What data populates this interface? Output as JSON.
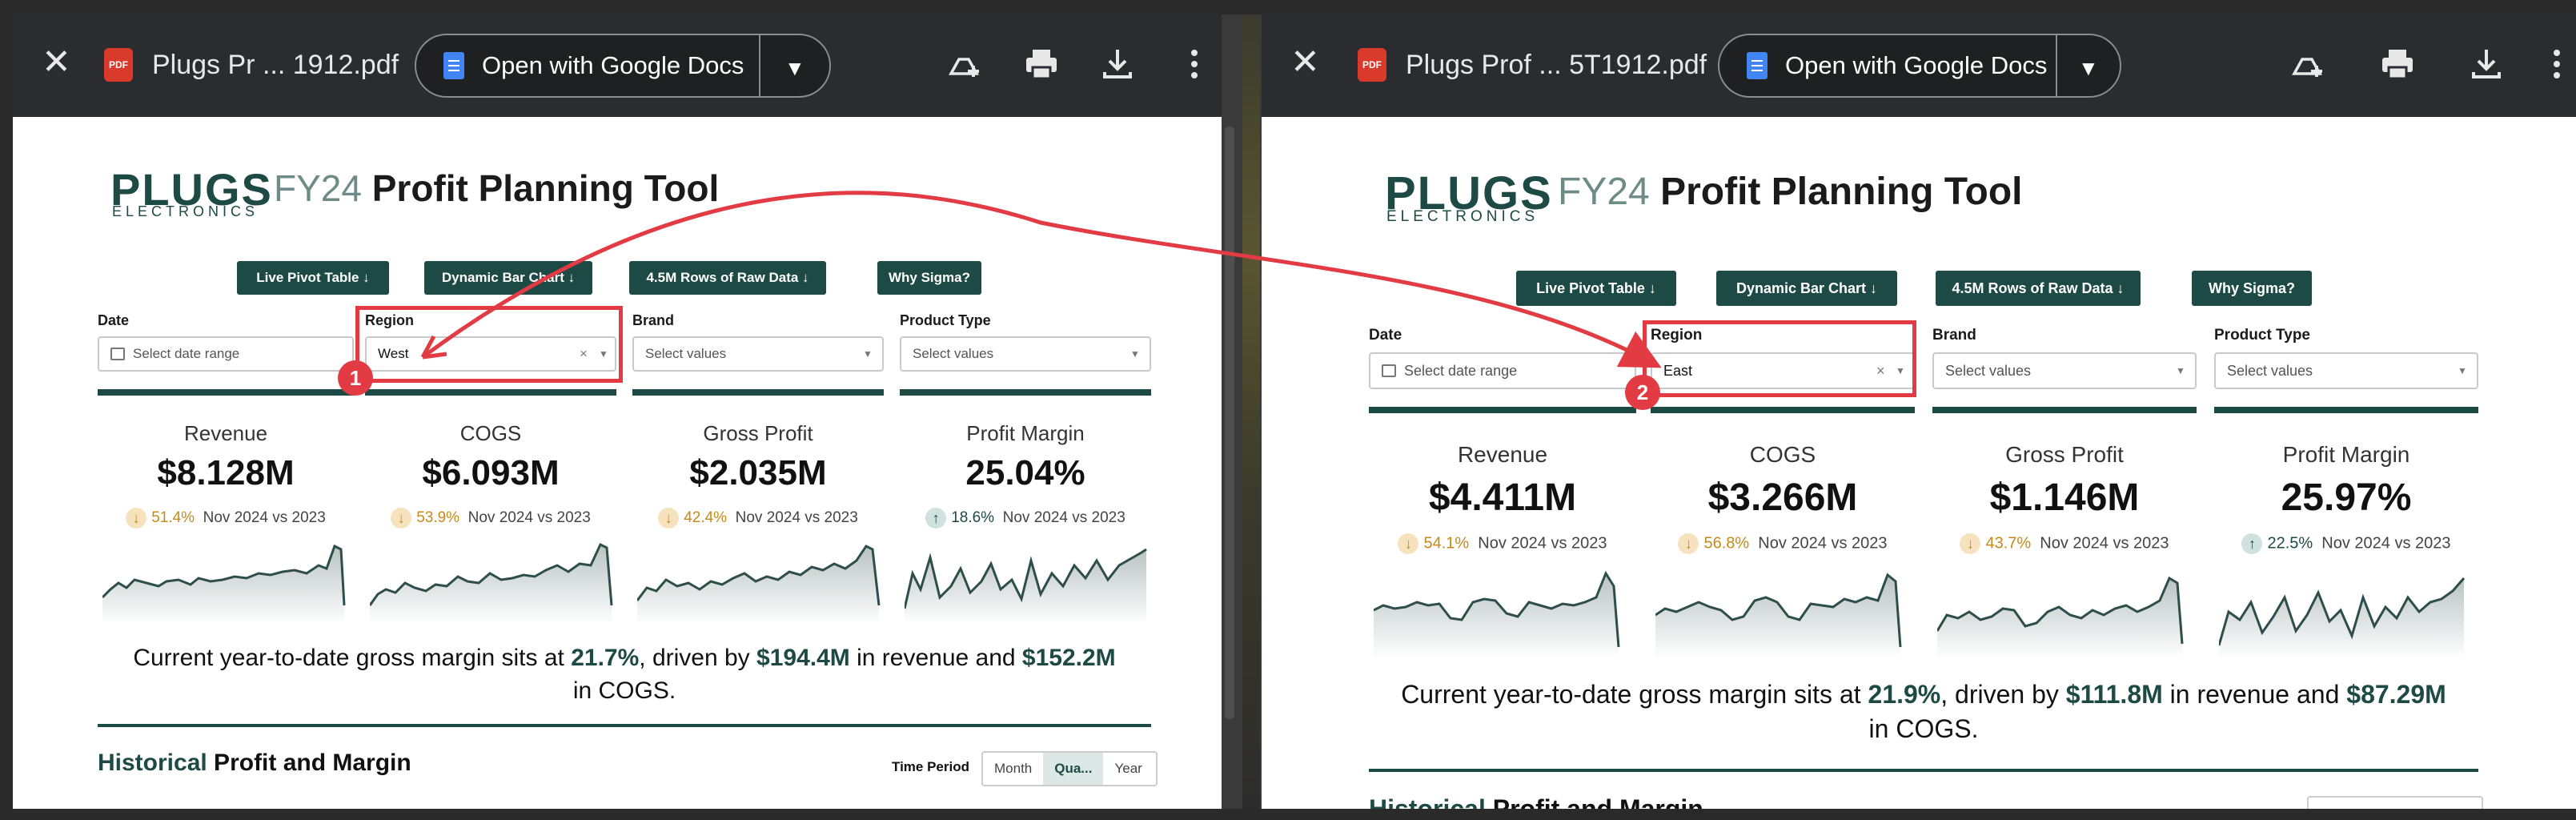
{
  "colors": {
    "brand": "#1d4a45",
    "highlight": "#e23b44",
    "toolbar": "#2b2c30",
    "down": "#c58a1a",
    "up": "#1d4a45"
  },
  "icons": [
    "close-icon",
    "pdf-icon",
    "google-docs-icon",
    "chevron-down-icon",
    "add-to-drive-icon",
    "print-icon",
    "download-icon",
    "more-vert-icon",
    "calendar-icon",
    "clear-icon",
    "arrow-down-icon",
    "arrow-up-icon"
  ],
  "left": {
    "toolbar": {
      "file_name": "Plugs Pr ... 1912.pdf",
      "pdf_badge": "PDF",
      "open_with": "Open with Google Docs"
    },
    "logo": {
      "word": "PLUGS",
      "sub": "ELECTRONICS"
    },
    "title": {
      "fy": "FY24",
      "rest": "Profit Planning Tool"
    },
    "nav": [
      "Live Pivot Table ↓",
      "Dynamic Bar Chart ↓",
      "4.5M Rows of Raw Data ↓",
      "Why Sigma?"
    ],
    "filters": {
      "date": {
        "label": "Date",
        "placeholder": "Select date range"
      },
      "region": {
        "label": "Region",
        "value": "West"
      },
      "brand": {
        "label": "Brand",
        "placeholder": "Select values"
      },
      "product_type": {
        "label": "Product Type",
        "placeholder": "Select values"
      }
    },
    "marker": "1",
    "kpis": [
      {
        "label": "Revenue",
        "value": "$8.128M",
        "pct": "51.4%",
        "dir": "down",
        "comp": "Nov 2024 vs 2023"
      },
      {
        "label": "COGS",
        "value": "$6.093M",
        "pct": "53.9%",
        "dir": "down",
        "comp": "Nov 2024 vs 2023"
      },
      {
        "label": "Gross Profit",
        "value": "$2.035M",
        "pct": "42.4%",
        "dir": "down",
        "comp": "Nov 2024 vs 2023"
      },
      {
        "label": "Profit Margin",
        "value": "25.04%",
        "pct": "18.6%",
        "dir": "up",
        "comp": "Nov 2024 vs 2023"
      }
    ],
    "summary": {
      "pre": "Current year-to-date gross margin sits at ",
      "margin": "21.7%",
      "mid": ", driven by ",
      "revenue": "$194.4M",
      "mid2": " in revenue and ",
      "cogs": "$152.2M",
      "post": " in COGS."
    },
    "historical": {
      "h1": "Historical",
      "h2": " Profit and Margin"
    },
    "time_period": {
      "label": "Time Period",
      "options": [
        "Month",
        "Qua...",
        "Year"
      ],
      "selected": "Qua..."
    }
  },
  "right": {
    "toolbar": {
      "file_name": "Plugs Prof ... 5T1912.pdf",
      "pdf_badge": "PDF",
      "open_with": "Open with Google Docs"
    },
    "logo": {
      "word": "PLUGS",
      "sub": "ELECTRONICS"
    },
    "title": {
      "fy": "FY24",
      "rest": "Profit Planning Tool"
    },
    "nav": [
      "Live Pivot Table ↓",
      "Dynamic Bar Chart ↓",
      "4.5M Rows of Raw Data ↓",
      "Why Sigma?"
    ],
    "filters": {
      "date": {
        "label": "Date",
        "placeholder": "Select date range"
      },
      "region": {
        "label": "Region",
        "value": "East"
      },
      "brand": {
        "label": "Brand",
        "placeholder": "Select values"
      },
      "product_type": {
        "label": "Product Type",
        "placeholder": "Select values"
      }
    },
    "marker": "2",
    "kpis": [
      {
        "label": "Revenue",
        "value": "$4.411M",
        "pct": "54.1%",
        "dir": "down",
        "comp": "Nov 2024 vs 2023"
      },
      {
        "label": "COGS",
        "value": "$3.266M",
        "pct": "56.8%",
        "dir": "down",
        "comp": "Nov 2024 vs 2023"
      },
      {
        "label": "Gross Profit",
        "value": "$1.146M",
        "pct": "43.7%",
        "dir": "down",
        "comp": "Nov 2024 vs 2023"
      },
      {
        "label": "Profit Margin",
        "value": "25.97%",
        "pct": "22.5%",
        "dir": "up",
        "comp": "Nov 2024 vs 2023"
      }
    ],
    "summary": {
      "pre": "Current year-to-date gross margin sits at ",
      "margin": "21.9%",
      "mid": ", driven by ",
      "revenue": "$111.8M",
      "mid2": " in revenue and ",
      "cogs": "$87.29M",
      "post": " in COGS."
    },
    "historical": {
      "h1": "Historical",
      "h2": " Profit and Margin"
    }
  }
}
